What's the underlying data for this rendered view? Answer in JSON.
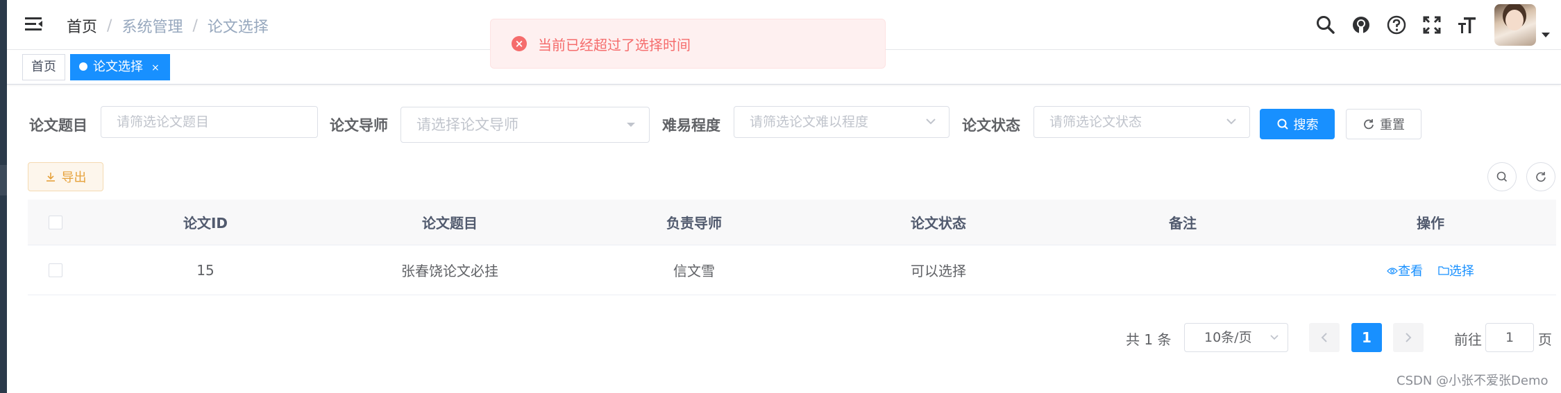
{
  "breadcrumb": {
    "home": "首页",
    "items": [
      "系统管理",
      "论文选择"
    ]
  },
  "navbar_icons": [
    "search-icon",
    "github-icon",
    "question-icon",
    "fullscreen-icon",
    "text-size-icon"
  ],
  "tags": {
    "home": "首页",
    "active": "论文选择",
    "close": "×"
  },
  "toast": {
    "message": "当前已经超过了选择时间",
    "color": "#f56c6c"
  },
  "search": {
    "title_label": "论文题目",
    "title_placeholder": "请筛选论文题目",
    "advisor_label": "论文导师",
    "advisor_placeholder": "请选择论文导师",
    "difficulty_label": "难易程度",
    "difficulty_placeholder": "请筛选论文难以程度",
    "status_label": "论文状态",
    "status_placeholder": "请筛选论文状态",
    "search_button": "搜索",
    "reset_button": "重置"
  },
  "toolbar": {
    "export_button": "导出"
  },
  "table": {
    "headers": [
      "论文ID",
      "论文题目",
      "负责导师",
      "论文状态",
      "备注",
      "操作"
    ],
    "rows": [
      {
        "id": "15",
        "title": "张春饶论文必挂",
        "advisor": "信文雪",
        "status": "可以选择",
        "note": "",
        "view": "查看",
        "select": "选择"
      }
    ]
  },
  "pagination": {
    "total": "共 1 条",
    "page_size": "10条/页",
    "current": "1",
    "goto_label": "前往",
    "goto_value": "1",
    "page_label": "页"
  },
  "watermark": "CSDN @小张不爱张Demo",
  "colors": {
    "primary": "#1890ff",
    "danger": "#f56c6c",
    "warning": "#e6a23c"
  }
}
